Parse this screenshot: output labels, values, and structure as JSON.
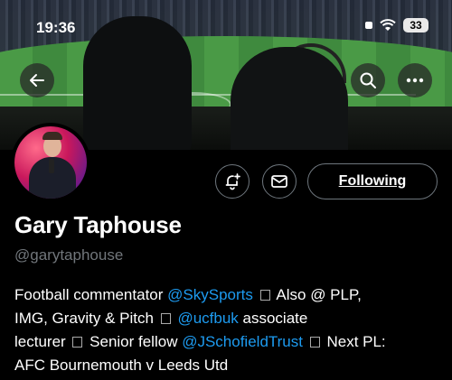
{
  "status_bar": {
    "time": "19:36",
    "battery": "33"
  },
  "profile": {
    "name": "Gary Taphouse",
    "handle": "@garytaphouse",
    "following_label": "Following"
  },
  "bio": {
    "t1": "Football commentator ",
    "m1": "@SkySports",
    "t2": " Also @ PLP,",
    "t3": "IMG, Gravity & Pitch ",
    "m2": "@ucfbuk",
    "t4": " associate",
    "t5": "lecturer ",
    "t6": " Senior fellow ",
    "m3": "@JSchofieldTrust",
    "t7": " Next PL:",
    "t8": "AFC Bournemouth v Leeds Utd"
  },
  "icons": {
    "back": "back-arrow-icon",
    "search": "search-icon",
    "more": "more-icon",
    "notify": "bell-plus-icon",
    "message": "envelope-icon"
  }
}
